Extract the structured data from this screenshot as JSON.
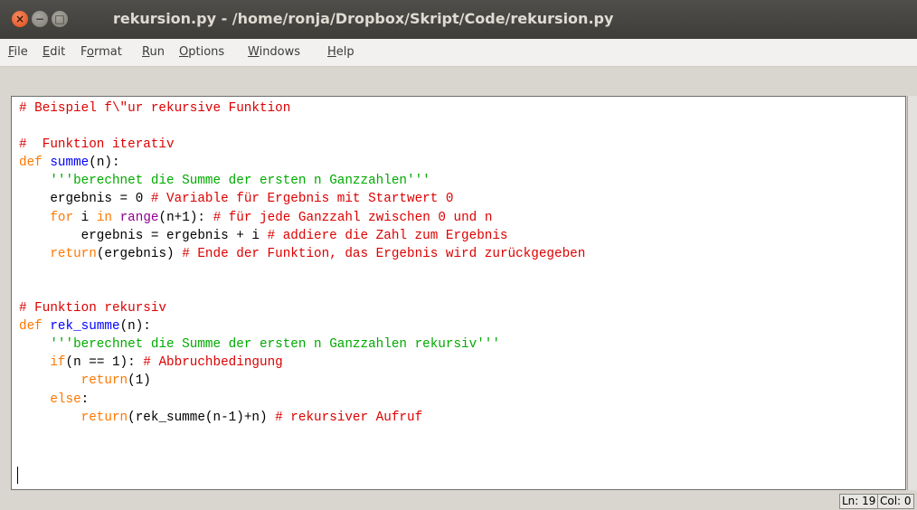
{
  "window": {
    "title": "rekursion.py - /home/ronja/Dropbox/Skript/Code/rekursion.py",
    "buttons": {
      "close": "×",
      "minimize": "−",
      "maximize": "□"
    }
  },
  "menubar": {
    "items": [
      {
        "pre": "",
        "mnemonic": "F",
        "post": "ile"
      },
      {
        "pre": "",
        "mnemonic": "E",
        "post": "dit"
      },
      {
        "pre": "F",
        "mnemonic": "o",
        "post": "rmat"
      },
      {
        "pre": "",
        "mnemonic": "R",
        "post": "un"
      },
      {
        "pre": "",
        "mnemonic": "O",
        "post": "ptions"
      },
      {
        "pre": "",
        "mnemonic": "W",
        "post": "indows"
      },
      {
        "pre": "",
        "mnemonic": "H",
        "post": "elp"
      }
    ]
  },
  "editor": {
    "lines": [
      [
        {
          "t": "# Beispiel f\\\"ur rekursive Funktion",
          "c": "c"
        }
      ],
      [],
      [
        {
          "t": "#  Funktion iterativ",
          "c": "c"
        }
      ],
      [
        {
          "t": "def",
          "c": "k"
        },
        {
          "t": " "
        },
        {
          "t": "summe",
          "c": "d"
        },
        {
          "t": "(n):"
        }
      ],
      [
        {
          "t": "    "
        },
        {
          "t": "'''berechnet die Summe der ersten n Ganzzahlen'''",
          "c": "s"
        }
      ],
      [
        {
          "t": "    ergebnis = 0 "
        },
        {
          "t": "# Variable für Ergebnis mit Startwert 0",
          "c": "c"
        }
      ],
      [
        {
          "t": "    "
        },
        {
          "t": "for",
          "c": "k"
        },
        {
          "t": " i "
        },
        {
          "t": "in",
          "c": "k"
        },
        {
          "t": " "
        },
        {
          "t": "range",
          "c": "b"
        },
        {
          "t": "(n+1): "
        },
        {
          "t": "# für jede Ganzzahl zwischen 0 und n",
          "c": "c"
        }
      ],
      [
        {
          "t": "        ergebnis = ergebnis + i "
        },
        {
          "t": "# addiere die Zahl zum Ergebnis",
          "c": "c"
        }
      ],
      [
        {
          "t": "    "
        },
        {
          "t": "return",
          "c": "k"
        },
        {
          "t": "(ergebnis) "
        },
        {
          "t": "# Ende der Funktion, das Ergebnis wird zurückgegeben",
          "c": "c"
        }
      ],
      [],
      [],
      [
        {
          "t": "# Funktion rekursiv",
          "c": "c"
        }
      ],
      [
        {
          "t": "def",
          "c": "k"
        },
        {
          "t": " "
        },
        {
          "t": "rek_summe",
          "c": "d"
        },
        {
          "t": "(n):"
        }
      ],
      [
        {
          "t": "    "
        },
        {
          "t": "'''berechnet die Summe der ersten n Ganzzahlen rekursiv'''",
          "c": "s"
        }
      ],
      [
        {
          "t": "    "
        },
        {
          "t": "if",
          "c": "k"
        },
        {
          "t": "(n == 1): "
        },
        {
          "t": "# Abbruchbedingung",
          "c": "c"
        }
      ],
      [
        {
          "t": "        "
        },
        {
          "t": "return",
          "c": "k"
        },
        {
          "t": "(1)"
        }
      ],
      [
        {
          "t": "    "
        },
        {
          "t": "else",
          "c": "k"
        },
        {
          "t": ":"
        }
      ],
      [
        {
          "t": "        "
        },
        {
          "t": "return",
          "c": "k"
        },
        {
          "t": "(rek_summe(n-1)+n) "
        },
        {
          "t": "# rekursiver Aufruf",
          "c": "c"
        }
      ],
      []
    ]
  },
  "statusbar": {
    "line": "Ln: 19",
    "col": "Col: 0"
  }
}
